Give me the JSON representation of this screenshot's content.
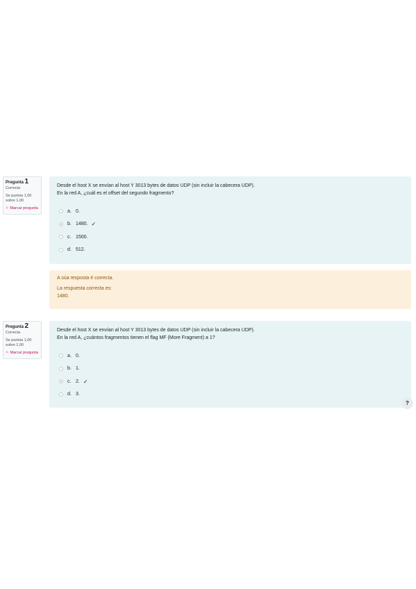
{
  "questions": [
    {
      "label": "Pregunta",
      "number": "1",
      "state": "Correcta",
      "grade": "Se puntúa 1,00 sobre 1,00",
      "flag_label": "Marcar pregunta",
      "text": [
        "Desde el host X se envían al host Y 3013 bytes de datos UDP (sin incluir la cabecera UDP).",
        "En la red A, ¿cuál es el offset del segundo fragmento?"
      ],
      "answers": [
        {
          "letter": "a.",
          "text": "0.",
          "checked": false,
          "correct": false
        },
        {
          "letter": "b.",
          "text": "1480.",
          "checked": true,
          "correct": true
        },
        {
          "letter": "c.",
          "text": "1500.",
          "checked": false,
          "correct": false
        },
        {
          "letter": "d.",
          "text": "512.",
          "checked": false,
          "correct": false
        }
      ],
      "feedback": {
        "status": "A súa resposta é correcta.",
        "correct_label": "La respuesta correcta es:",
        "correct_value": "1480."
      }
    },
    {
      "label": "Pregunta",
      "number": "2",
      "state": "Correcta",
      "grade": "Se puntúa 1,00 sobre 1,00",
      "flag_label": "Marcar pregunta",
      "text": [
        "Desde el host X se envían al host Y 3013 bytes de datos UDP (sin incluir la cabecera UDP).",
        "En la red A, ¿cuántos fragmentos tienen el flag MF (More Fragment) a 1?"
      ],
      "answers": [
        {
          "letter": "a.",
          "text": "0.",
          "checked": false,
          "correct": false
        },
        {
          "letter": "b.",
          "text": "1.",
          "checked": false,
          "correct": false
        },
        {
          "letter": "c.",
          "text": "2.",
          "checked": true,
          "correct": true
        },
        {
          "letter": "d.",
          "text": "3.",
          "checked": false,
          "correct": false
        }
      ]
    }
  ],
  "help": {
    "label": "?"
  },
  "icons": {
    "correct": "check-icon",
    "flag": "flag-icon",
    "help": "question-mark-icon"
  }
}
